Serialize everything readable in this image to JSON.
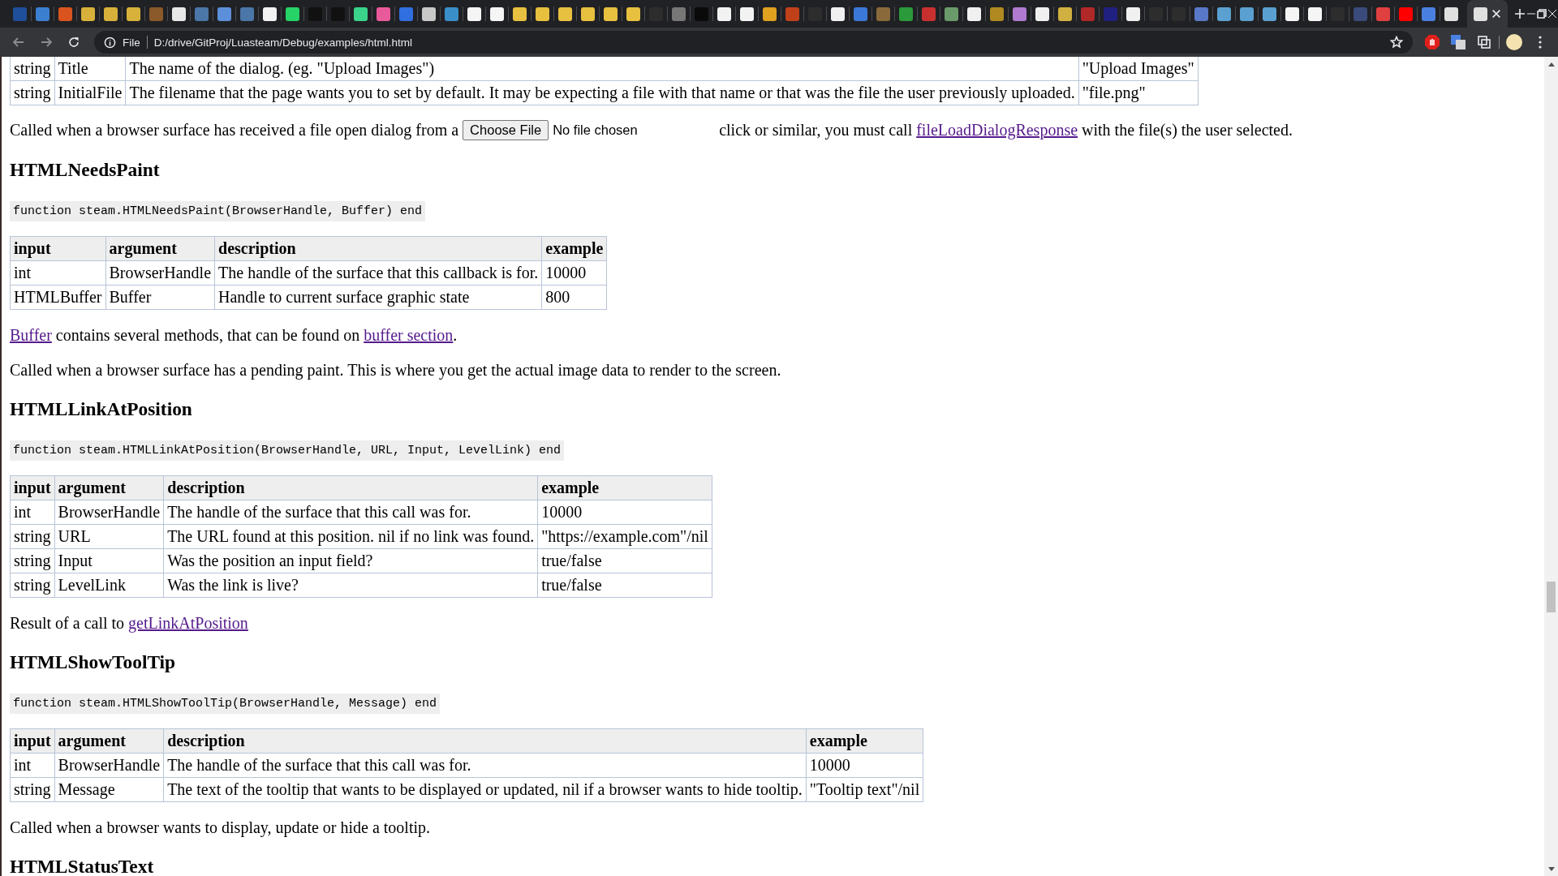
{
  "browser": {
    "tabs": [
      {
        "color": "#1f4e9a",
        "selected": false
      },
      {
        "color": "#3b7fd0",
        "selected": false
      },
      {
        "color": "#d9541e",
        "selected": false
      },
      {
        "color": "#d8b13a",
        "selected": false
      },
      {
        "color": "#d8b13a",
        "selected": false
      },
      {
        "color": "#d8b13a",
        "selected": false
      },
      {
        "color": "#8a5a2b",
        "selected": false
      },
      {
        "color": "#e8e8e8",
        "selected": false
      },
      {
        "color": "#4a76a8",
        "selected": false
      },
      {
        "color": "#5b8fd9",
        "selected": false
      },
      {
        "color": "#4a76a8",
        "selected": false
      },
      {
        "color": "#f2f2f2",
        "selected": false
      },
      {
        "color": "#25d366",
        "selected": false
      },
      {
        "color": "#111111",
        "selected": false
      },
      {
        "color": "#111111",
        "selected": false
      },
      {
        "color": "#3ad48a",
        "selected": false
      },
      {
        "color": "#e85a9a",
        "selected": false
      },
      {
        "color": "#2f6fe0",
        "selected": false
      },
      {
        "color": "#c8c8c8",
        "selected": false
      },
      {
        "color": "#3a8fc8",
        "selected": false
      },
      {
        "color": "#f5f5f5",
        "selected": false
      },
      {
        "color": "#f5f5f5",
        "selected": false
      },
      {
        "color": "#e8c040",
        "selected": false
      },
      {
        "color": "#e8c040",
        "selected": false
      },
      {
        "color": "#e8c040",
        "selected": false
      },
      {
        "color": "#e8c040",
        "selected": false
      },
      {
        "color": "#e8c040",
        "selected": false
      },
      {
        "color": "#e8c040",
        "selected": false
      },
      {
        "color": "#2d2d2d",
        "selected": false
      },
      {
        "color": "#777777",
        "selected": false
      },
      {
        "color": "#0a0a0a",
        "selected": false
      },
      {
        "color": "#f2f2f2",
        "selected": false
      },
      {
        "color": "#f2f2f2",
        "selected": false
      },
      {
        "color": "#e0a020",
        "selected": false
      },
      {
        "color": "#c0401a",
        "selected": false
      },
      {
        "color": "#2d2d2d",
        "selected": false
      },
      {
        "color": "#f0f0f0",
        "selected": false
      },
      {
        "color": "#3b78d8",
        "selected": false
      },
      {
        "color": "#8a6a3a",
        "selected": false
      },
      {
        "color": "#2a9a3a",
        "selected": false
      },
      {
        "color": "#c83030",
        "selected": false
      },
      {
        "color": "#6a9a6a",
        "selected": false
      },
      {
        "color": "#f0f0f0",
        "selected": false
      },
      {
        "color": "#b08a20",
        "selected": false
      },
      {
        "color": "#b07ad0",
        "selected": false
      },
      {
        "color": "#f0f0f0",
        "selected": false
      },
      {
        "color": "#d0b040",
        "selected": false
      },
      {
        "color": "#b02828",
        "selected": false
      },
      {
        "color": "#202080",
        "selected": false
      },
      {
        "color": "#f0f0f0",
        "selected": false
      },
      {
        "color": "#2d2d2d",
        "selected": false
      },
      {
        "color": "#2d2d2d",
        "selected": false
      },
      {
        "color": "#5a78c8",
        "selected": false
      },
      {
        "color": "#5aa0d0",
        "selected": false
      },
      {
        "color": "#5aa0d0",
        "selected": false
      },
      {
        "color": "#5aa0d0",
        "selected": false
      },
      {
        "color": "#f5f5f5",
        "selected": false
      },
      {
        "color": "#f5f5f5",
        "selected": false
      },
      {
        "color": "#2d2d2d",
        "selected": false
      },
      {
        "color": "#3a4a7a",
        "selected": false
      },
      {
        "color": "#e04040",
        "selected": false
      },
      {
        "color": "#ff0000",
        "selected": false
      },
      {
        "color": "#4a80e0",
        "selected": false
      },
      {
        "color": "#e0e0e0",
        "selected": false
      },
      {
        "color": "#e0e0e0",
        "selected": true
      }
    ],
    "address": {
      "scheme": "File",
      "url": "D:/drive/GitProj/Luasteam/Debug/examples/html.html"
    }
  },
  "page": {
    "top_table": {
      "rows": [
        [
          "string",
          "Title",
          "The name of the dialog. (eg. \"Upload Images\")",
          "\"Upload Images\""
        ],
        [
          "string",
          "InitialFile",
          "The filename that the page wants you to set by default. It may be expecting a file with that name or that was the file the user previously uploaded.",
          "\"file.png\""
        ]
      ]
    },
    "file_dialog_paragraph": {
      "before": "Called when a browser surface has received a file open dialog from a",
      "button": "Choose File",
      "status": "No file chosen",
      "after": "click or similar, you must call",
      "link": "fileLoadDialogResponse",
      "end": "with the file(s) the user selected."
    },
    "sections": [
      {
        "heading": "HTMLNeedsPaint",
        "code": "function steam.HTMLNeedsPaint(BrowserHandle, Buffer) end",
        "columns": [
          "input",
          "argument",
          "description",
          "example"
        ],
        "rows": [
          [
            "int",
            "BrowserHandle",
            "The handle of the surface that this callback is for.",
            "10000"
          ],
          [
            "HTMLBuffer",
            "Buffer",
            "Handle to current surface graphic state",
            "800"
          ]
        ],
        "paragraphs": [
          [
            {
              "text": "Buffer",
              "link": true
            },
            {
              "text": " contains several methods, that can be found on ",
              "link": false
            },
            {
              "text": "buffer section",
              "link": true
            },
            {
              "text": ".",
              "link": false
            }
          ],
          [
            {
              "text": "Called when a browser surface has a pending paint. This is where you get the actual image data to render to the screen.",
              "link": false
            }
          ]
        ]
      },
      {
        "heading": "HTMLLinkAtPosition",
        "code": "function steam.HTMLLinkAtPosition(BrowserHandle, URL, Input, LevelLink) end",
        "columns": [
          "input",
          "argument",
          "description",
          "example"
        ],
        "rows": [
          [
            "int",
            "BrowserHandle",
            "The handle of the surface that this call was for.",
            "10000"
          ],
          [
            "string",
            "URL",
            "The URL found at this position. nil if no link was found.",
            "\"https://example.com\"/nil"
          ],
          [
            "string",
            "Input",
            "Was the position an input field?",
            "true/false"
          ],
          [
            "string",
            "LevelLink",
            "Was the link is live?",
            "true/false"
          ]
        ],
        "paragraphs": [
          [
            {
              "text": "Result of a call to ",
              "link": false
            },
            {
              "text": "getLinkAtPosition",
              "link": true
            }
          ]
        ]
      },
      {
        "heading": "HTMLShowToolTip",
        "code": "function steam.HTMLShowToolTip(BrowserHandle, Message) end",
        "columns": [
          "input",
          "argument",
          "description",
          "example"
        ],
        "rows": [
          [
            "int",
            "BrowserHandle",
            "The handle of the surface that this call was for.",
            "10000"
          ],
          [
            "string",
            "Message",
            "The text of the tooltip that wants to be displayed or updated, nil if a browser wants to hide tooltip.",
            "\"Tooltip text\"/nil"
          ]
        ],
        "paragraphs": [
          [
            {
              "text": "Called when a browser wants to display, update or hide a tooltip.",
              "link": false
            }
          ]
        ]
      },
      {
        "heading": "HTMLStatusText"
      }
    ]
  }
}
